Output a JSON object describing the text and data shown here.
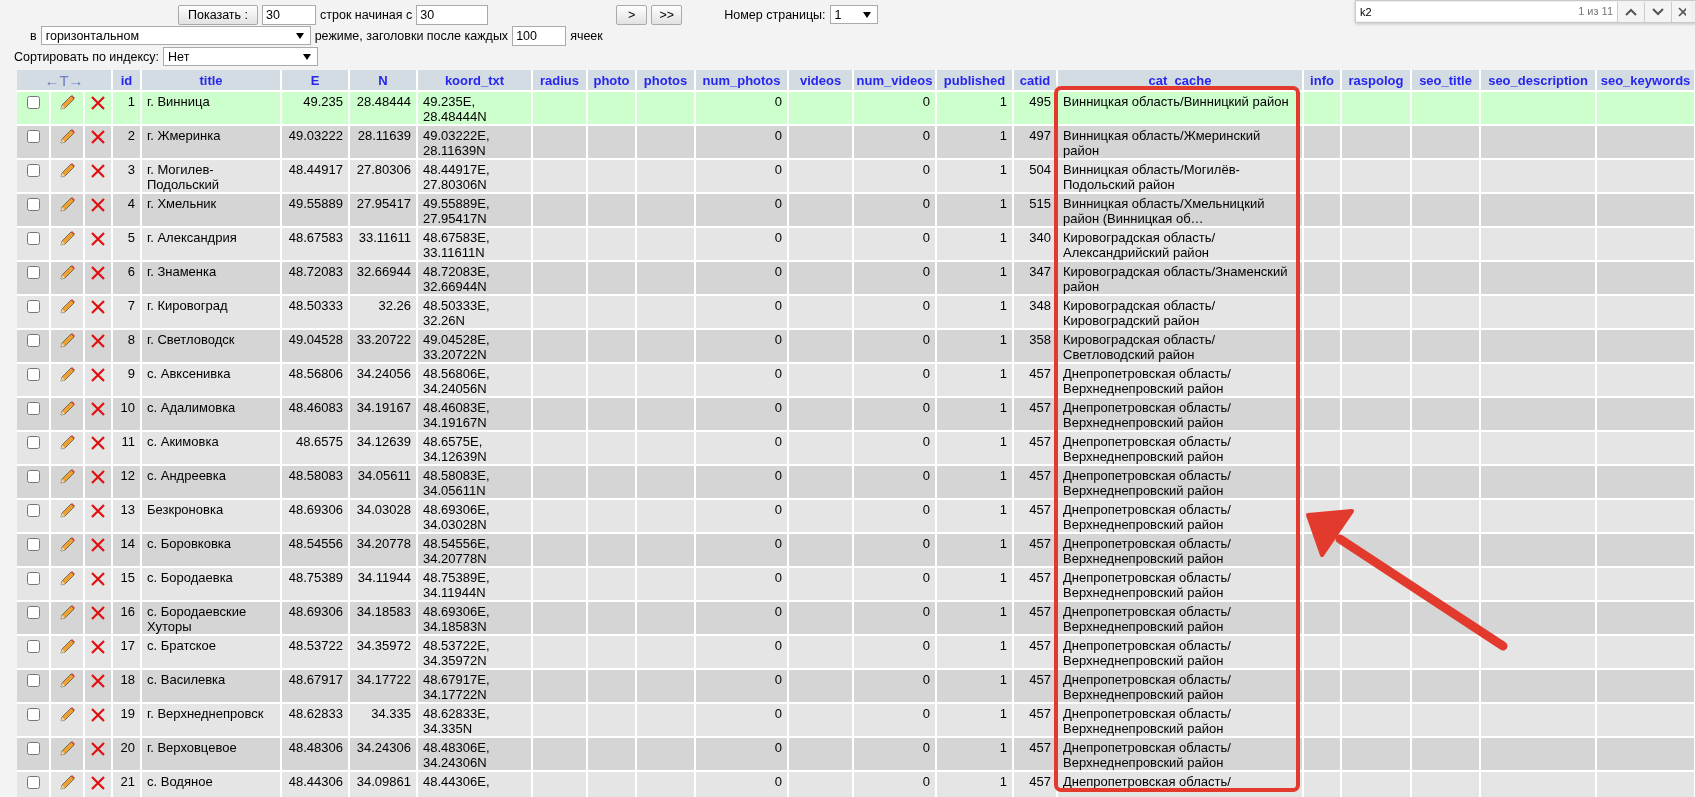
{
  "toolbar": {
    "show_button": "Показать :",
    "rows_count": "30",
    "rows_label": "строк начиная с",
    "start_row": "30",
    "next_button": ">",
    "last_button": ">>",
    "page_label": "Номер страницы:",
    "page_select": "1",
    "mode_prefix": "в",
    "mode_select": "горизонтальном",
    "mode_label": "режиме, заголовки после каждых",
    "repeat_cells": "100",
    "cells_label": "ячеек",
    "sort_label": "Сортировать по индексу:",
    "sort_select": "Нет"
  },
  "find_bar": {
    "query": "k2",
    "matches": "1 из 11"
  },
  "table": {
    "action_header": "←T→",
    "columns": [
      "id",
      "title",
      "E",
      "N",
      "koord_txt",
      "radius",
      "photo",
      "photos",
      "num_photos",
      "videos",
      "num_videos",
      "published",
      "catid",
      "cat_cache",
      "info",
      "raspolog",
      "seo_title",
      "seo_description",
      "seo_keywords"
    ],
    "rows": [
      {
        "checked": false,
        "highlighted": true,
        "id": "1",
        "title": "г. Винница",
        "E": "49.235",
        "N": "28.48444",
        "koord_txt": "49.235E, 28.48444N",
        "num_photos": "0",
        "num_videos": "0",
        "published": "1",
        "catid": "495",
        "cat_cache": "Винницкая область/Винницкий район"
      },
      {
        "checked": false,
        "highlighted": false,
        "id": "2",
        "title": "г. Жмеринка",
        "E": "49.03222",
        "N": "28.11639",
        "koord_txt": "49.03222E, 28.11639N",
        "num_photos": "0",
        "num_videos": "0",
        "published": "1",
        "catid": "497",
        "cat_cache": "Винницкая область/Жмеринский район"
      },
      {
        "checked": false,
        "highlighted": false,
        "id": "3",
        "title": "г. Могилев-Подольский",
        "E": "48.44917",
        "N": "27.80306",
        "koord_txt": "48.44917E, 27.80306N",
        "num_photos": "0",
        "num_videos": "0",
        "published": "1",
        "catid": "504",
        "cat_cache": "Винницкая область/Могилёв-Подольский район"
      },
      {
        "checked": false,
        "highlighted": false,
        "id": "4",
        "title": "г. Хмельник",
        "E": "49.55889",
        "N": "27.95417",
        "koord_txt": "49.55889E, 27.95417N",
        "num_photos": "0",
        "num_videos": "0",
        "published": "1",
        "catid": "515",
        "cat_cache": "Винницкая область/Хмельницкий район (Винницкая об…"
      },
      {
        "checked": false,
        "highlighted": false,
        "id": "5",
        "title": "г. Александрия",
        "E": "48.67583",
        "N": "33.11611",
        "koord_txt": "48.67583E, 33.11611N",
        "num_photos": "0",
        "num_videos": "0",
        "published": "1",
        "catid": "340",
        "cat_cache": "Кировоградская область/Александрийский район"
      },
      {
        "checked": false,
        "highlighted": false,
        "id": "6",
        "title": "г. Знаменка",
        "E": "48.72083",
        "N": "32.66944",
        "koord_txt": "48.72083E, 32.66944N",
        "num_photos": "0",
        "num_videos": "0",
        "published": "1",
        "catid": "347",
        "cat_cache": "Кировоградская область/Знаменский район"
      },
      {
        "checked": false,
        "highlighted": false,
        "id": "7",
        "title": "г. Кировоград",
        "E": "48.50333",
        "N": "32.26",
        "koord_txt": "48.50333E, 32.26N",
        "num_photos": "0",
        "num_videos": "0",
        "published": "1",
        "catid": "348",
        "cat_cache": "Кировоградская область/Кировоградский район"
      },
      {
        "checked": false,
        "highlighted": false,
        "id": "8",
        "title": "г. Светловодск",
        "E": "49.04528",
        "N": "33.20722",
        "koord_txt": "49.04528E, 33.20722N",
        "num_photos": "0",
        "num_videos": "0",
        "published": "1",
        "catid": "358",
        "cat_cache": "Кировоградская область/Светловодский район"
      },
      {
        "checked": false,
        "highlighted": false,
        "id": "9",
        "title": "с. Авксенивка",
        "E": "48.56806",
        "N": "34.24056",
        "koord_txt": "48.56806E, 34.24056N",
        "num_photos": "0",
        "num_videos": "0",
        "published": "1",
        "catid": "457",
        "cat_cache": "Днепропетровская область/Верхнеднепровский район"
      },
      {
        "checked": false,
        "highlighted": false,
        "id": "10",
        "title": "с. Адалимовка",
        "E": "48.46083",
        "N": "34.19167",
        "koord_txt": "48.46083E, 34.19167N",
        "num_photos": "0",
        "num_videos": "0",
        "published": "1",
        "catid": "457",
        "cat_cache": "Днепропетровская область/Верхнеднепровский район"
      },
      {
        "checked": false,
        "highlighted": false,
        "id": "11",
        "title": "с. Акимовка",
        "E": "48.6575",
        "N": "34.12639",
        "koord_txt": "48.6575E, 34.12639N",
        "num_photos": "0",
        "num_videos": "0",
        "published": "1",
        "catid": "457",
        "cat_cache": "Днепропетровская область/Верхнеднепровский район"
      },
      {
        "checked": false,
        "highlighted": false,
        "id": "12",
        "title": "с. Андреевка",
        "E": "48.58083",
        "N": "34.05611",
        "koord_txt": "48.58083E, 34.05611N",
        "num_photos": "0",
        "num_videos": "0",
        "published": "1",
        "catid": "457",
        "cat_cache": "Днепропетровская область/Верхнеднепровский район"
      },
      {
        "checked": false,
        "highlighted": false,
        "id": "13",
        "title": "Безкроновка",
        "E": "48.69306",
        "N": "34.03028",
        "koord_txt": "48.69306E, 34.03028N",
        "num_photos": "0",
        "num_videos": "0",
        "published": "1",
        "catid": "457",
        "cat_cache": "Днепропетровская область/Верхнеднепровский район"
      },
      {
        "checked": false,
        "highlighted": false,
        "id": "14",
        "title": "с. Боровковка",
        "E": "48.54556",
        "N": "34.20778",
        "koord_txt": "48.54556E, 34.20778N",
        "num_photos": "0",
        "num_videos": "0",
        "published": "1",
        "catid": "457",
        "cat_cache": "Днепропетровская область/Верхнеднепровский район"
      },
      {
        "checked": false,
        "highlighted": false,
        "id": "15",
        "title": "с. Бородаевка",
        "E": "48.75389",
        "N": "34.11944",
        "koord_txt": "48.75389E, 34.11944N",
        "num_photos": "0",
        "num_videos": "0",
        "published": "1",
        "catid": "457",
        "cat_cache": "Днепропетровская область/Верхнеднепровский район"
      },
      {
        "checked": false,
        "highlighted": false,
        "id": "16",
        "title": "с. Бородаевские Хуторы",
        "E": "48.69306",
        "N": "34.18583",
        "koord_txt": "48.69306E, 34.18583N",
        "num_photos": "0",
        "num_videos": "0",
        "published": "1",
        "catid": "457",
        "cat_cache": "Днепропетровская область/Верхнеднепровский район"
      },
      {
        "checked": false,
        "highlighted": false,
        "id": "17",
        "title": "с. Братское",
        "E": "48.53722",
        "N": "34.35972",
        "koord_txt": "48.53722E, 34.35972N",
        "num_photos": "0",
        "num_videos": "0",
        "published": "1",
        "catid": "457",
        "cat_cache": "Днепропетровская область/Верхнеднепровский район"
      },
      {
        "checked": false,
        "highlighted": false,
        "id": "18",
        "title": "с. Василевка",
        "E": "48.67917",
        "N": "34.17722",
        "koord_txt": "48.67917E, 34.17722N",
        "num_photos": "0",
        "num_videos": "0",
        "published": "1",
        "catid": "457",
        "cat_cache": "Днепропетровская область/Верхнеднепровский район"
      },
      {
        "checked": false,
        "highlighted": false,
        "id": "19",
        "title": "г. Верхнеднепровск",
        "E": "48.62833",
        "N": "34.335",
        "koord_txt": "48.62833E, 34.335N",
        "num_photos": "0",
        "num_videos": "0",
        "published": "1",
        "catid": "457",
        "cat_cache": "Днепропетровская область/Верхнеднепровский район"
      },
      {
        "checked": false,
        "highlighted": false,
        "id": "20",
        "title": "г. Верховцевое",
        "E": "48.48306",
        "N": "34.24306",
        "koord_txt": "48.48306E, 34.24306N",
        "num_photos": "0",
        "num_videos": "0",
        "published": "1",
        "catid": "457",
        "cat_cache": "Днепропетровская область/Верхнеднепровский район"
      },
      {
        "checked": false,
        "highlighted": false,
        "id": "21",
        "title": "с. Водяное",
        "E": "48.44306",
        "N": "34.09861",
        "koord_txt": "48.44306E,",
        "num_photos": "0",
        "num_videos": "0",
        "published": "1",
        "catid": "457",
        "cat_cache": "Днепропетровская область/"
      }
    ]
  }
}
